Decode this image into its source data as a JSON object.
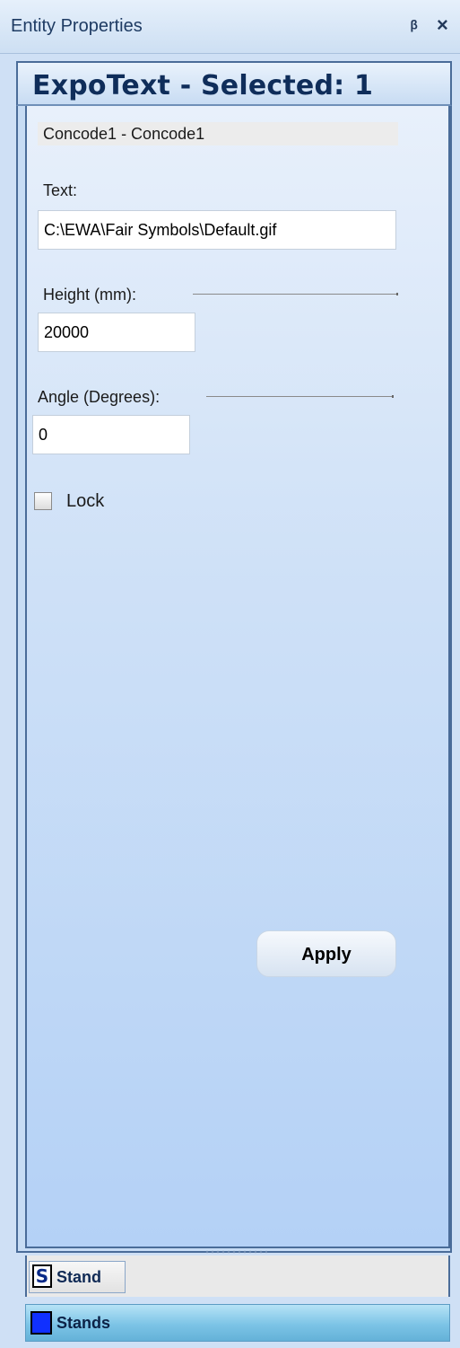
{
  "window": {
    "title": "Entity Properties"
  },
  "header": {
    "title": "ExpoText - Selected: 1"
  },
  "entity": {
    "name": "Concode1 - Concode1"
  },
  "fields": {
    "text": {
      "label": "Text:",
      "value": "C:\\EWA\\Fair Symbols\\Default.gif"
    },
    "height": {
      "label": "Height (mm):",
      "value": "20000"
    },
    "angle": {
      "label": "Angle (Degrees):",
      "value": "0"
    }
  },
  "lock": {
    "label": "Lock",
    "checked": false
  },
  "buttons": {
    "apply": "Apply"
  },
  "tabs": {
    "stand": {
      "icon_letter": "S",
      "label": "Stand"
    }
  },
  "nav": {
    "stands": "Stands"
  },
  "icons": {
    "pin": "pin-icon",
    "close": "close-icon",
    "stand": "s-letter-icon",
    "stands": "blue-square-icon"
  },
  "colors": {
    "accent": "#4a6c99",
    "stands_bar": "#7cc4e6",
    "stands_icon": "#1030ff"
  }
}
